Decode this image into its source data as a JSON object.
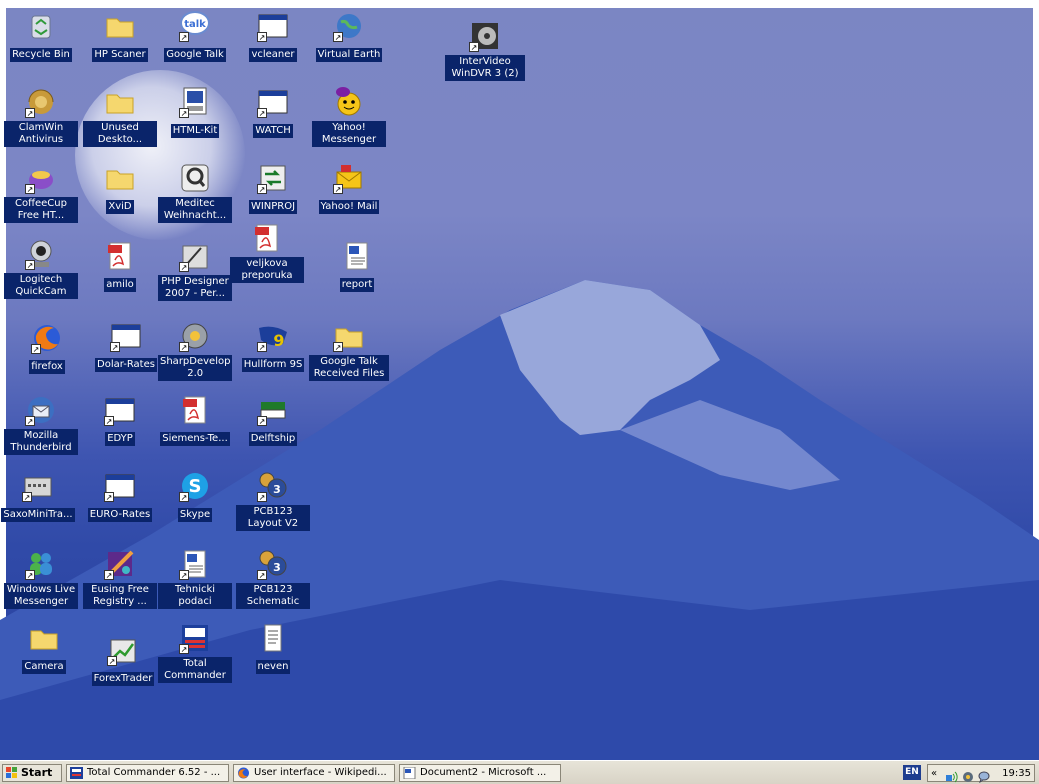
{
  "desktop": {
    "icons": [
      {
        "id": "recycle-bin",
        "label": "Recycle Bin",
        "icon": "recycle-bin-icon"
      },
      {
        "id": "hp-scaner",
        "label": "HP Scaner",
        "icon": "folder-icon"
      },
      {
        "id": "google-talk",
        "label": "Google Talk",
        "icon": "google-talk-icon"
      },
      {
        "id": "vcleaner",
        "label": "vcleaner",
        "icon": "program-window-icon"
      },
      {
        "id": "virtual-earth",
        "label": "Virtual Earth",
        "icon": "virtual-earth-icon"
      },
      {
        "id": "intervideo-windvr",
        "label": "InterVideo WinDVR 3 (2)",
        "icon": "windvr-icon"
      },
      {
        "id": "clamwin",
        "label": "ClamWin Antivirus",
        "icon": "clamwin-icon"
      },
      {
        "id": "unused-desktop",
        "label": "Unused Deskto...",
        "icon": "folder-icon"
      },
      {
        "id": "html-kit",
        "label": "HTML-Kit",
        "icon": "html-kit-icon"
      },
      {
        "id": "watch",
        "label": "WATCH",
        "icon": "program-window-icon"
      },
      {
        "id": "yahoo-messenger",
        "label": "Yahoo! Messenger",
        "icon": "yahoo-messenger-icon"
      },
      {
        "id": "coffeecup",
        "label": "CoffeeCup Free HT...",
        "icon": "coffeecup-icon"
      },
      {
        "id": "xvid",
        "label": "XviD",
        "icon": "folder-icon"
      },
      {
        "id": "meditec",
        "label": "Meditec Weihnacht...",
        "icon": "meditec-icon"
      },
      {
        "id": "winproj",
        "label": "WINPROJ",
        "icon": "winproj-icon"
      },
      {
        "id": "yahoo-mail",
        "label": "Yahoo! Mail",
        "icon": "yahoo-mail-icon"
      },
      {
        "id": "veljkova",
        "label": "veljkova preporuka",
        "icon": "pdf-icon"
      },
      {
        "id": "logitech",
        "label": "Logitech QuickCam",
        "icon": "webcam-icon"
      },
      {
        "id": "amilo",
        "label": "amilo",
        "icon": "pdf-icon"
      },
      {
        "id": "php-designer",
        "label": "PHP Designer 2007 - Per...",
        "icon": "php-designer-icon"
      },
      {
        "id": "report",
        "label": "report",
        "icon": "word-document-icon"
      },
      {
        "id": "firefox",
        "label": "firefox",
        "icon": "firefox-icon"
      },
      {
        "id": "dolar-rates",
        "label": "Dolar-Rates",
        "icon": "program-window-icon"
      },
      {
        "id": "sharpdevelop",
        "label": "SharpDevelop 2.0",
        "icon": "sharpdevelop-icon"
      },
      {
        "id": "hullform",
        "label": "Hullform 9S",
        "icon": "hullform-icon"
      },
      {
        "id": "google-talk-files",
        "label": "Google Talk Received Files",
        "icon": "folder-icon"
      },
      {
        "id": "thunderbird",
        "label": "Mozilla Thunderbird",
        "icon": "thunderbird-icon"
      },
      {
        "id": "edyp",
        "label": "EDYP",
        "icon": "program-window-icon"
      },
      {
        "id": "siemens",
        "label": "Siemens-Te...",
        "icon": "pdf-icon"
      },
      {
        "id": "delftship",
        "label": "Delftship",
        "icon": "delftship-icon"
      },
      {
        "id": "saxomini",
        "label": "SaxoMiniTra...",
        "icon": "saxo-icon"
      },
      {
        "id": "euro-rates",
        "label": "EURO-Rates",
        "icon": "program-window-icon"
      },
      {
        "id": "skype",
        "label": "Skype",
        "icon": "skype-icon"
      },
      {
        "id": "pcb123-layout",
        "label": "PCB123 Layout V2",
        "icon": "pcb123-icon"
      },
      {
        "id": "wlm",
        "label": "Windows Live Messenger",
        "icon": "live-messenger-icon"
      },
      {
        "id": "eusing",
        "label": "Eusing Free Registry ...",
        "icon": "registry-cleaner-icon"
      },
      {
        "id": "tehnicki",
        "label": "Tehnicki podaci",
        "icon": "word-document-icon"
      },
      {
        "id": "pcb123-schematic",
        "label": "PCB123 Schematic",
        "icon": "pcb123-icon"
      },
      {
        "id": "camera",
        "label": "Camera",
        "icon": "folder-icon"
      },
      {
        "id": "forextrader",
        "label": "ForexTrader",
        "icon": "forex-icon"
      },
      {
        "id": "total-commander",
        "label": "Total Commander",
        "icon": "total-commander-icon"
      },
      {
        "id": "neven",
        "label": "neven",
        "icon": "text-file-icon"
      }
    ]
  },
  "taskbar": {
    "start_label": "Start",
    "tasks": [
      {
        "label": "Total Commander 6.52 - ...",
        "icon": "total-commander-icon"
      },
      {
        "label": "User interface - Wikipedi...",
        "icon": "firefox-icon"
      },
      {
        "label": "Document2 - Microsoft ...",
        "icon": "word-document-icon"
      }
    ],
    "language": "EN",
    "tray_chevron": "«",
    "clock": "19:35"
  },
  "colors": {
    "label_bg": "#0a246a",
    "taskbar_bg": "#ddd8cb"
  }
}
